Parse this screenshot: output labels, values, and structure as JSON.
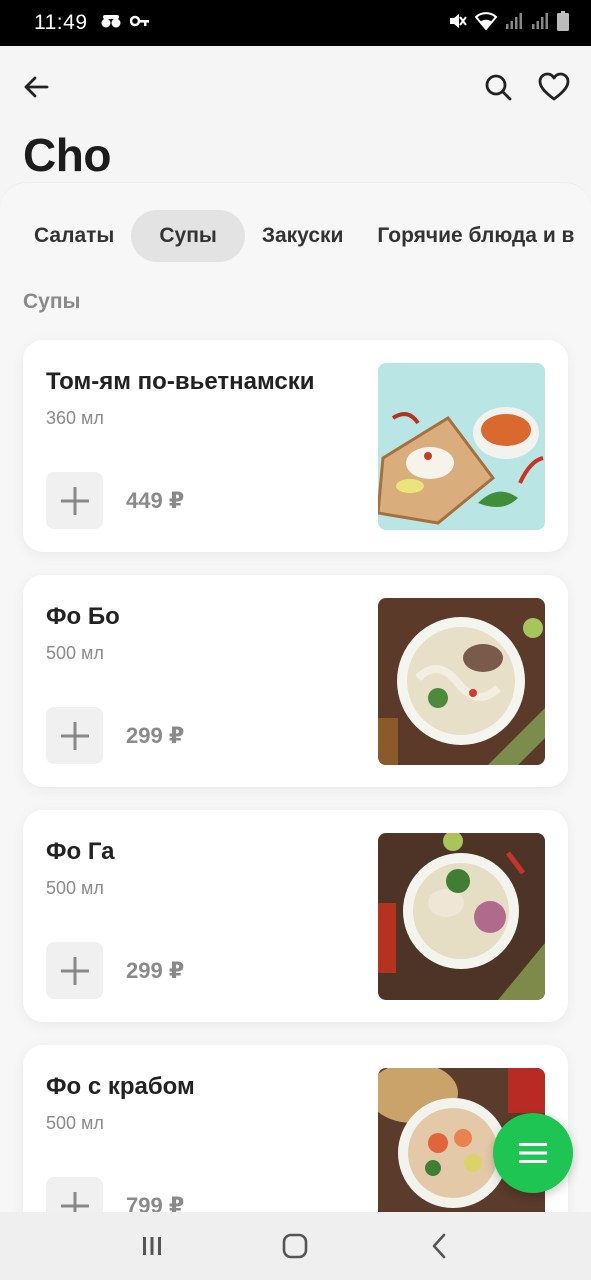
{
  "status_bar": {
    "time": "11:49",
    "left_icons": [
      "incognito-icon",
      "key-icon"
    ],
    "right_icons": [
      "mute-icon",
      "wifi-icon",
      "signal-icon",
      "signal-icon",
      "battery-icon"
    ]
  },
  "header": {
    "title": "Cho",
    "icons": [
      "back-arrow-icon",
      "search-icon",
      "heart-icon"
    ]
  },
  "tabs": [
    {
      "label": "Салаты",
      "active": false
    },
    {
      "label": "Супы",
      "active": true
    },
    {
      "label": "Закуски",
      "active": false
    },
    {
      "label": "Горячие блюда и в",
      "active": false
    }
  ],
  "section_title": "Супы",
  "items": [
    {
      "name": "Том-ям по-вьетнамски",
      "volume": "360 мл",
      "price": "449 ₽"
    },
    {
      "name": "Фо Бо",
      "volume": "500 мл",
      "price": "299 ₽"
    },
    {
      "name": "Фо Га",
      "volume": "500 мл",
      "price": "299 ₽"
    },
    {
      "name": "Фо с крабом",
      "volume": "500 мл",
      "price": "799 ₽"
    }
  ],
  "fab_icon": "menu-icon",
  "nav_icons": [
    "recent-apps-icon",
    "home-icon",
    "back-icon"
  ],
  "colors": {
    "accent": "#1ec552",
    "active_tab": "#e3e3e3"
  }
}
